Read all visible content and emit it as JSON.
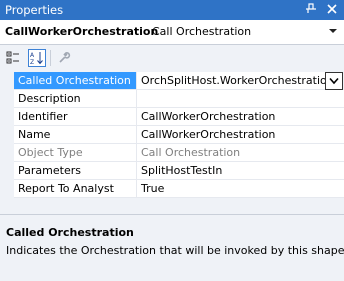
{
  "window": {
    "title": "Properties",
    "pin_icon": "pin-icon",
    "close_icon": "close-icon"
  },
  "object_selector": {
    "name": "CallWorkerOrchestration",
    "type": "Call Orchestration"
  },
  "toolbar": {
    "buttons": [
      {
        "icon": "categorized-icon",
        "active": false
      },
      {
        "icon": "alphabetical-icon",
        "active": true
      },
      {
        "icon": "property-pages-icon",
        "active": false
      }
    ]
  },
  "properties": [
    {
      "name": "Called Orchestration",
      "value": "OrchSplitHost.WorkerOrchestration",
      "selected": true,
      "readonly": false
    },
    {
      "name": "Description",
      "value": "",
      "selected": false,
      "readonly": false
    },
    {
      "name": "Identifier",
      "value": "CallWorkerOrchestration",
      "selected": false,
      "readonly": false
    },
    {
      "name": "Name",
      "value": "CallWorkerOrchestration",
      "selected": false,
      "readonly": false
    },
    {
      "name": "Object Type",
      "value": "Call Orchestration",
      "selected": false,
      "readonly": true
    },
    {
      "name": "Parameters",
      "value": "SplitHostTestIn",
      "selected": false,
      "readonly": false
    },
    {
      "name": "Report To Analyst",
      "value": "True",
      "selected": false,
      "readonly": false
    }
  ],
  "description": {
    "title": "Called Orchestration",
    "text": "Indicates the Orchestration that will be invoked by this shape."
  },
  "colors": {
    "title_bar": "#2f73c6",
    "selection": "#3399ff",
    "panel": "#eff2f7"
  }
}
